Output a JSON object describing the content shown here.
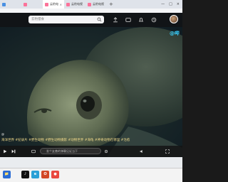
{
  "browser": {
    "tabs": [
      {
        "label": "",
        "active": false
      },
      {
        "label": "",
        "active": false
      },
      {
        "label": "云豹电视 - 哔哩哔哩",
        "active": true
      },
      {
        "label": "云豹电视 - 哔哩哔哩",
        "active": false
      },
      {
        "label": "云豹电视 - 哔哩哔哩",
        "active": false
      }
    ],
    "new_tab_symbol": "+",
    "close_symbol": "×",
    "window_controls": [
      "—",
      "□",
      "×"
    ]
  },
  "header": {
    "search_placeholder": "云豹猎食",
    "accent": "#fb7299"
  },
  "video": {
    "watermark": "@哔",
    "uploader_handle": "@",
    "caption": "海洋世界 #纪录片 #野生动物 #野生动物摄影 #动物世界 #海龟 #神奇动物在哪里 #治愈"
  },
  "player": {
    "comment_placeholder": "发个友善的弹幕见证当下"
  },
  "taskbar": {
    "apps": [
      {
        "name": "explorer-icon",
        "color": "#2b6cd4",
        "glyph": "📁"
      },
      {
        "name": "tiktok-icon",
        "color": "#111111",
        "glyph": "♪"
      },
      {
        "name": "edge-icon",
        "color": "#2aa0d6",
        "glyph": "e"
      },
      {
        "name": "office-icon",
        "color": "#d24726",
        "glyph": "O"
      },
      {
        "name": "chrome-icon",
        "color": "#e9483f",
        "glyph": "●"
      }
    ]
  }
}
